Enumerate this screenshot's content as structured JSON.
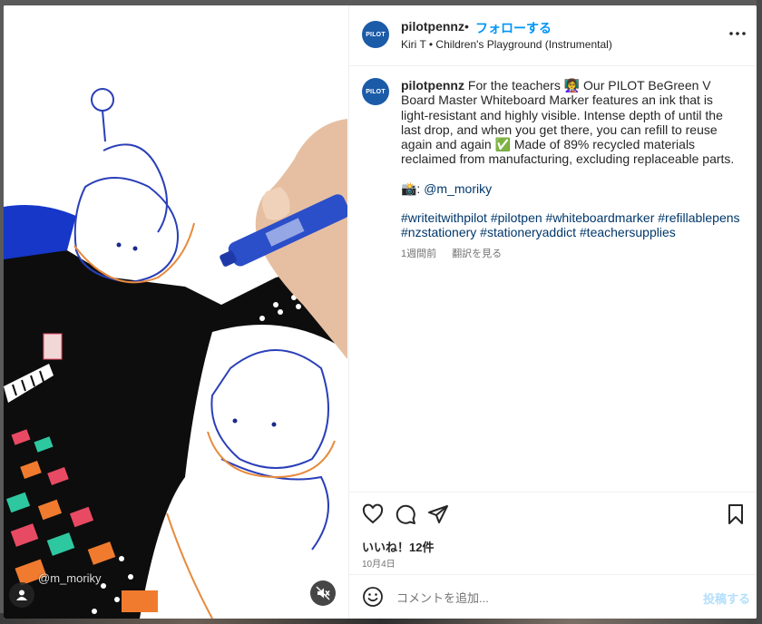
{
  "post": {
    "username": "pilotpennz",
    "separator": "•",
    "follow_label": "フォローする",
    "audio": "Kiri T • Children's Playground (Instrumental)",
    "avatar_text": "PILOT",
    "media_credit": "@m_moriky"
  },
  "caption": {
    "username": "pilotpennz",
    "text_line1": " For the teachers 👩‍🏫 Our PILOT BeGreen V Board Master Whiteboard Marker features an ink that is light-resistant and highly visible. Intense depth of until the last drop, and when you get there, you can refill to reuse again and again ✅ Made of 89% recycled materials reclaimed from manufacturing, excluding replaceable parts.",
    "photo_prefix": "📸: ",
    "photo_credit": "@m_moriky",
    "hashtags": "#writeitwithpilot #pilotpen #whiteboardmarker #refillablepens #nzstationery #stationeryaddict #teachersupplies",
    "time_ago": "1週間前",
    "translate_label": "翻訳を見る"
  },
  "engagement": {
    "likes_text": "いいね！12件",
    "date_text": "10月4日"
  },
  "comment": {
    "placeholder": "コメントを追加...",
    "post_label": "投稿する"
  },
  "icons": {
    "like": "heart-icon",
    "comment": "comment-icon",
    "share": "paper-plane-icon",
    "save": "bookmark-icon",
    "emoji": "smiley-icon",
    "more": "more-horizontal-icon",
    "mute": "sound-off-icon",
    "user_tag": "user-tag-icon"
  },
  "colors": {
    "follow": "#0095f6",
    "brand": "#1c5ba8",
    "link": "#00376b",
    "post_disabled": "#b2dffc"
  }
}
